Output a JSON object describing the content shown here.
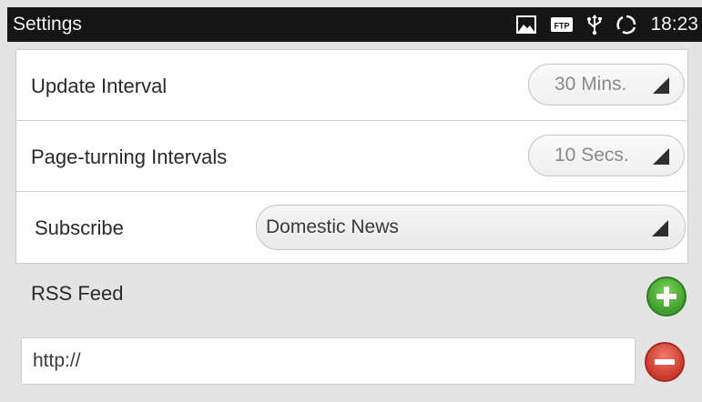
{
  "statusbar": {
    "title": "Settings",
    "time": "18:23",
    "icons": [
      "image-icon",
      "ftp-icon",
      "usb-icon",
      "sync-icon"
    ],
    "ftp_label": "FTP"
  },
  "settings": {
    "update_interval": {
      "label": "Update Interval",
      "value": "30 Mins."
    },
    "page_turning": {
      "label": "Page-turning Intervals",
      "value": "10 Secs."
    },
    "subscribe": {
      "label": "Subscribe",
      "value": "Domestic News"
    }
  },
  "rss": {
    "label": "RSS Feed",
    "url_value": "http://"
  },
  "colors": {
    "statusbar_bg": "#151515",
    "add_green": "#4caf35",
    "remove_red": "#d9402f",
    "background": "#e4e4e4"
  }
}
